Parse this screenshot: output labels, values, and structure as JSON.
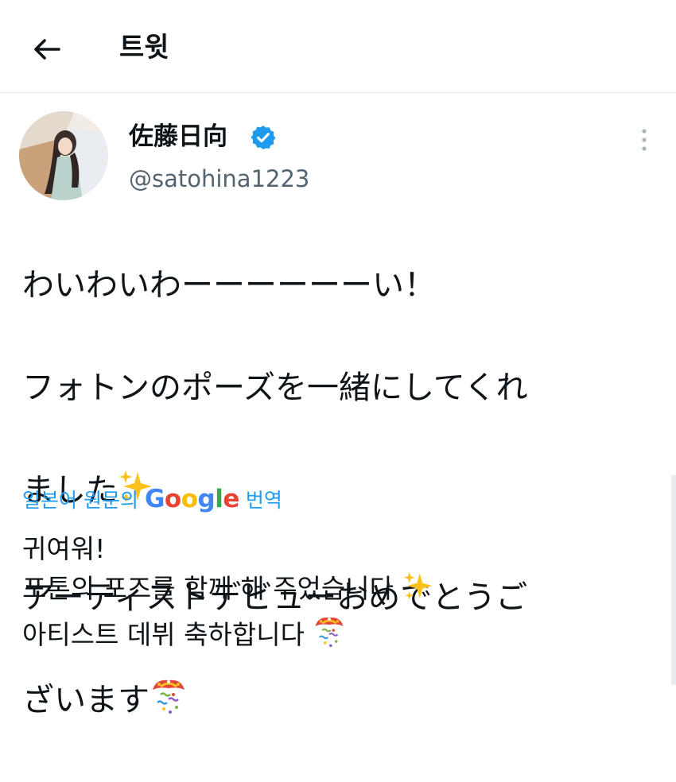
{
  "header": {
    "title": "트윗",
    "back_icon": "arrow-left-icon"
  },
  "author": {
    "display_name": "佐藤日向",
    "handle": "@satohina1223",
    "verified": true,
    "verified_color": "#1d9bf0"
  },
  "tweet": {
    "lines": [
      "わいわいわーーーーーーい！",
      "フォトンのポーズを一緒にしてくれ",
      "ました",
      "アーティストデビューおめでとうご",
      "ざいます"
    ],
    "emojis": [
      "sparkles",
      "party-popper"
    ]
  },
  "translation": {
    "prefix": "일본어 원문의",
    "brand": "Google",
    "suffix": "번역",
    "link_color": "#1d9bf0",
    "lines": [
      "귀여워!",
      "포톤의 포즈를 함께 해 주었습니다",
      "아티스트 데뷔 축하합니다"
    ]
  }
}
